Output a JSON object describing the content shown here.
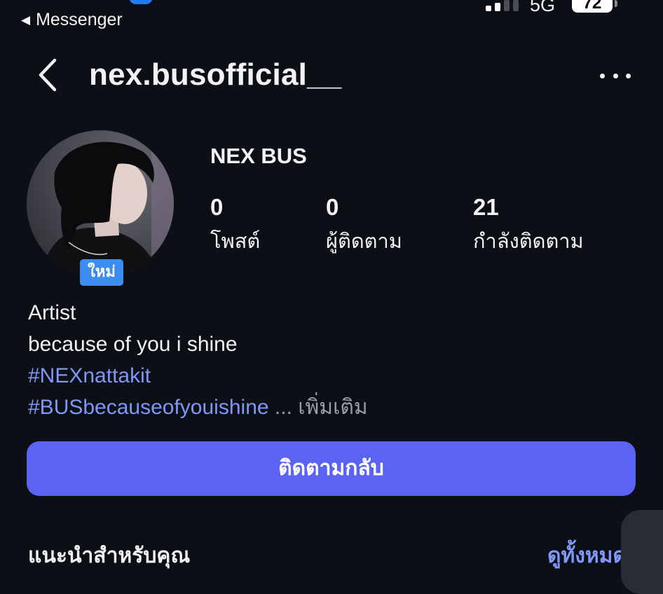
{
  "status_bar": {
    "back_app_label": "Messenger",
    "network": "5G",
    "battery": "72"
  },
  "header": {
    "username": "nex.busofficial__"
  },
  "profile": {
    "display_name": "NEX BUS",
    "new_badge": "ใหม่",
    "stats": [
      {
        "value": "0",
        "label": "โพสต์"
      },
      {
        "value": "0",
        "label": "ผู้ติดตาม"
      },
      {
        "value": "21",
        "label": "กำลังติดตาม"
      }
    ]
  },
  "bio": {
    "line1": "Artist",
    "line2": "because of you i shine",
    "hashtag1": "#NEXnattakit",
    "hashtag2": "#BUSbecauseofyouishine",
    "ellipsis": "...",
    "more_label": "เพิ่มเติม"
  },
  "actions": {
    "follow_back": "ติดตามกลับ"
  },
  "suggestions": {
    "title": "แนะนำสำหรับคุณ",
    "see_all": "ดูทั้งหมด"
  },
  "colors": {
    "background": "#0d0f16",
    "accent_button": "#5b63f2",
    "link": "#7f97f6",
    "badge": "#3d8cf0"
  }
}
